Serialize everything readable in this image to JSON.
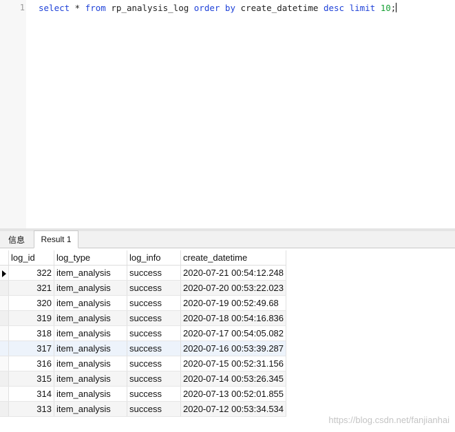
{
  "editor": {
    "line_number": "1",
    "query": {
      "t1": "select",
      "t2": " * ",
      "t3": "from",
      "t4": " rp_analysis_log ",
      "t5": "order by",
      "t6": " create_datetime ",
      "t7": "desc limit",
      "t8": " ",
      "t9": "10",
      "t10": ";"
    }
  },
  "tabs": [
    {
      "label": "信息"
    },
    {
      "label": "Result 1"
    }
  ],
  "grid": {
    "columns": [
      "log_id",
      "log_type",
      "log_info",
      "create_datetime"
    ],
    "rows": [
      {
        "log_id": "322",
        "log_type": "item_analysis",
        "log_info": "success",
        "create_datetime": "2020-07-21 00:54:12.248"
      },
      {
        "log_id": "321",
        "log_type": "item_analysis",
        "log_info": "success",
        "create_datetime": "2020-07-20 00:53:22.023"
      },
      {
        "log_id": "320",
        "log_type": "item_analysis",
        "log_info": "success",
        "create_datetime": "2020-07-19 00:52:49.68"
      },
      {
        "log_id": "319",
        "log_type": "item_analysis",
        "log_info": "success",
        "create_datetime": "2020-07-18 00:54:16.836"
      },
      {
        "log_id": "318",
        "log_type": "item_analysis",
        "log_info": "success",
        "create_datetime": "2020-07-17 00:54:05.082"
      },
      {
        "log_id": "317",
        "log_type": "item_analysis",
        "log_info": "success",
        "create_datetime": "2020-07-16 00:53:39.287"
      },
      {
        "log_id": "316",
        "log_type": "item_analysis",
        "log_info": "success",
        "create_datetime": "2020-07-15 00:52:31.156"
      },
      {
        "log_id": "315",
        "log_type": "item_analysis",
        "log_info": "success",
        "create_datetime": "2020-07-14 00:53:26.345"
      },
      {
        "log_id": "314",
        "log_type": "item_analysis",
        "log_info": "success",
        "create_datetime": "2020-07-13 00:52:01.855"
      },
      {
        "log_id": "313",
        "log_type": "item_analysis",
        "log_info": "success",
        "create_datetime": "2020-07-12 00:53:34.534"
      }
    ]
  },
  "watermark": "https://blog.csdn.net/fanjianhai",
  "colors": {
    "keyword": "#1f42d8",
    "number": "#17a035",
    "selected_header": "#dbe8f9"
  }
}
